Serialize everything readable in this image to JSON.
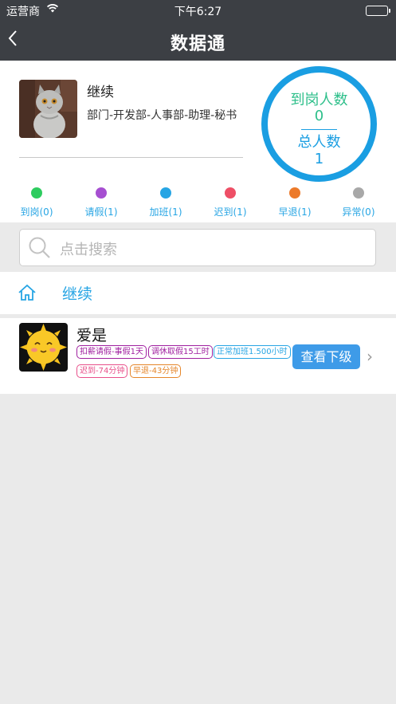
{
  "status_bar": {
    "carrier": "运营商",
    "time": "下午6:27"
  },
  "nav": {
    "back_glyph": "〈",
    "title": "数据通"
  },
  "profile": {
    "name": "继续",
    "department": "部门-开发部-人事部-助理-秘书"
  },
  "summary_ring": {
    "on_duty_label": "到岗人数",
    "on_duty_count": "0",
    "total_label": "总人数",
    "total_count": "1",
    "ring_color": "#1a9ee2",
    "on_duty_color": "#2dbf8a"
  },
  "legend": [
    {
      "label": "到岗(0)",
      "color": "#2ecc5f"
    },
    {
      "label": "请假(1)",
      "color": "#a64fd1"
    },
    {
      "label": "加班(1)",
      "color": "#27a5e4"
    },
    {
      "label": "迟到(1)",
      "color": "#ee4f66"
    },
    {
      "label": "早退(1)",
      "color": "#ec7a2a"
    },
    {
      "label": "异常(0)",
      "color": "#a8a8a8"
    }
  ],
  "search": {
    "placeholder": "点击搜索"
  },
  "breadcrumb": {
    "label": "继续"
  },
  "members": [
    {
      "name": "爱是",
      "tags": [
        {
          "text": "扣薪请假-事假1天",
          "color": "#a020a0"
        },
        {
          "text": "调休取假15工时",
          "color": "#a020a0"
        },
        {
          "text": "正常加班1.500小时",
          "color": "#27a5e4"
        },
        {
          "text": "迟到-74分钟",
          "color": "#e8508a"
        },
        {
          "text": "早退-43分钟",
          "color": "#e5862a"
        }
      ],
      "action_label": "查看下级",
      "chevron": "›"
    }
  ]
}
